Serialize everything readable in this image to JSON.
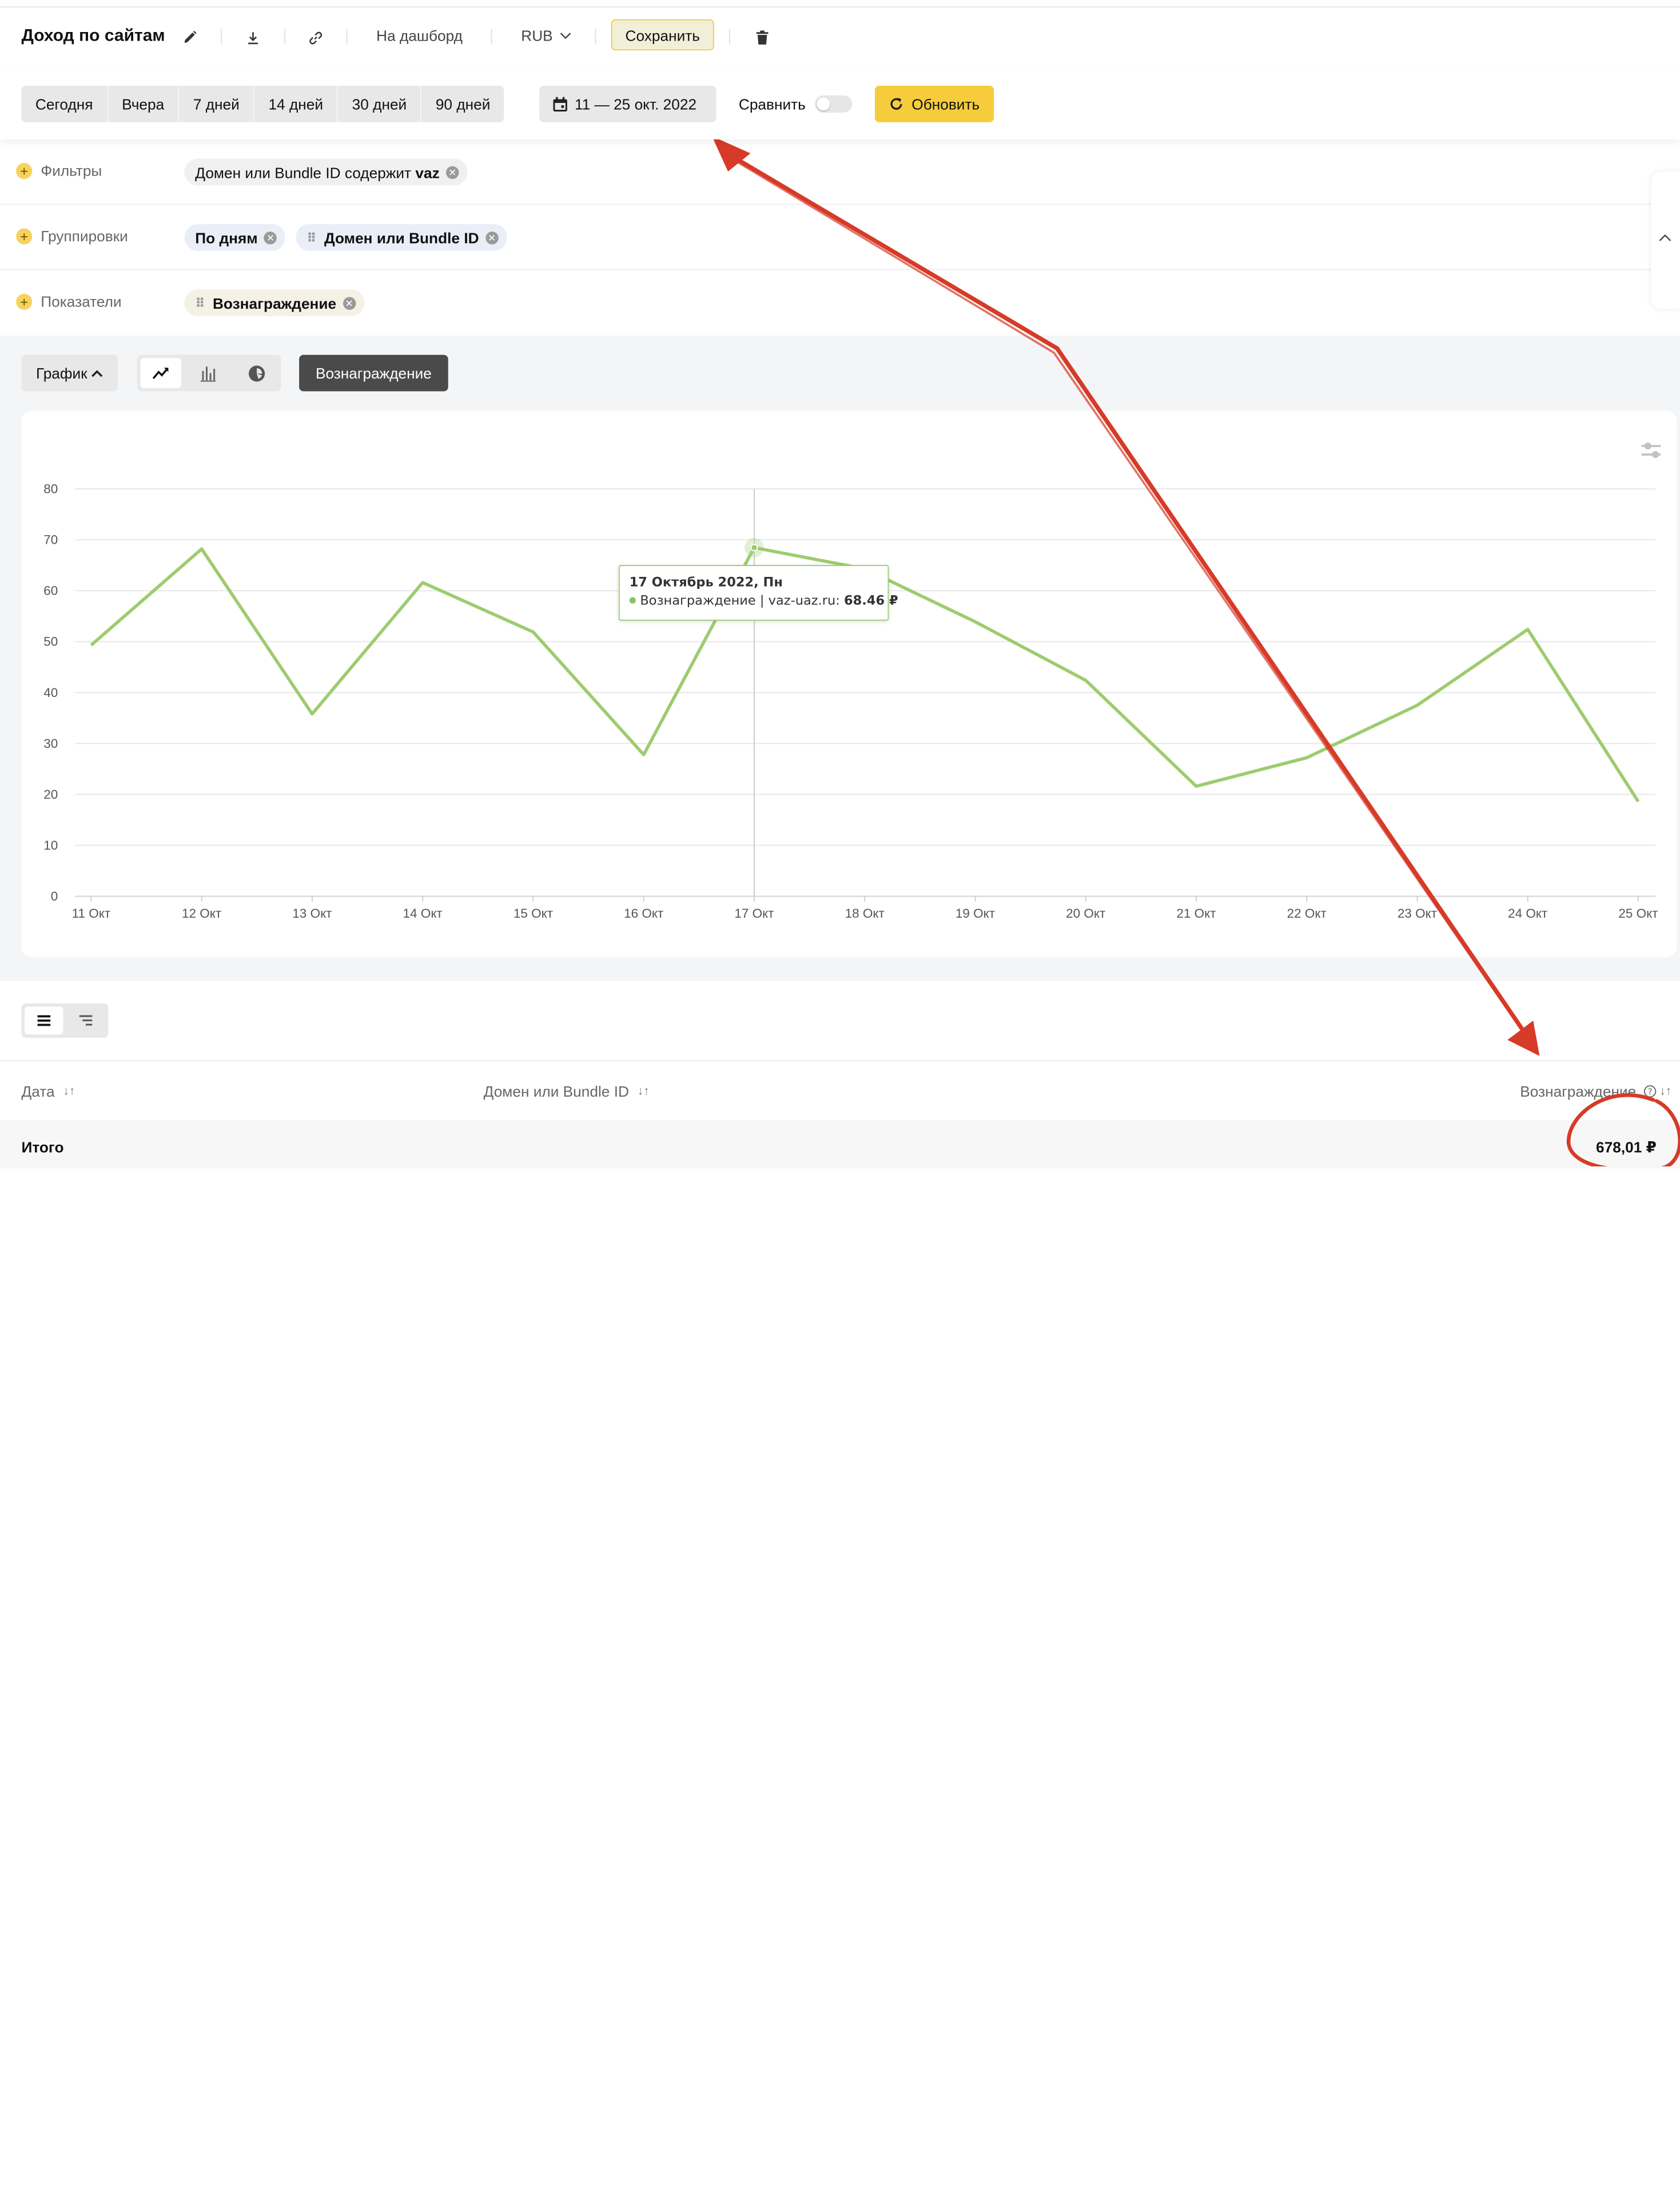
{
  "report": {
    "title": "Доход по сайтам",
    "actions": {
      "dashboard": "На дашборд",
      "currency": "RUB",
      "save": "Сохранить"
    }
  },
  "periods": [
    "Сегодня",
    "Вчера",
    "7 дней",
    "14 дней",
    "30 дней",
    "90 дней"
  ],
  "date_range": "11 — 25 окт. 2022",
  "compare": {
    "label": "Сравнить",
    "enabled": false
  },
  "refresh": "Обновить",
  "filters": {
    "label": "Фильтры",
    "chips": [
      {
        "text_plain": "Домен или Bundle ID содержит ",
        "text_bold": "vaz"
      }
    ]
  },
  "groupings": {
    "label": "Группировки",
    "chips": [
      "По дням",
      "Домен или Bundle ID"
    ]
  },
  "metrics": {
    "label": "Показатели",
    "chips": [
      "Вознаграждение"
    ]
  },
  "chart_controls": {
    "graph_label": "График",
    "active_view": "line",
    "metric_button": "Вознаграждение"
  },
  "tooltip": {
    "title": "17 Октябрь 2022, Пн",
    "series_text": "Вознаграждение | vaz-uaz.ru:",
    "value": "68.46 ₽"
  },
  "chart_data": {
    "type": "line",
    "categories": [
      "11 Окт",
      "12 Окт",
      "13 Окт",
      "14 Окт",
      "15 Окт",
      "16 Окт",
      "17 Окт",
      "18 Окт",
      "19 Окт",
      "20 Окт",
      "21 Окт",
      "22 Окт",
      "23 Окт",
      "24 Окт",
      "25 Окт"
    ],
    "series": [
      {
        "values": [
          49.3,
          68.2,
          35.8,
          61.6,
          51.9,
          27.8,
          68.46,
          64.3,
          53.9,
          42.4,
          21.6,
          27.2,
          37.5,
          52.4,
          18.6
        ],
        "color": "#9dcc6f"
      }
    ],
    "yticks": [
      0,
      10,
      20,
      30,
      40,
      50,
      60,
      70,
      80
    ],
    "ylim": [
      0,
      80
    ],
    "highlight_index": 6,
    "grid": true
  },
  "table": {
    "columns": [
      "Дата",
      "Домен или Bundle ID",
      "Вознаграждение"
    ],
    "total_label": "Итого",
    "total_value": "678,01 ₽"
  },
  "colors": {
    "accent_yellow": "#f7cc3c",
    "series_green": "#9dcc6f",
    "annotation_red": "#d63b28"
  }
}
